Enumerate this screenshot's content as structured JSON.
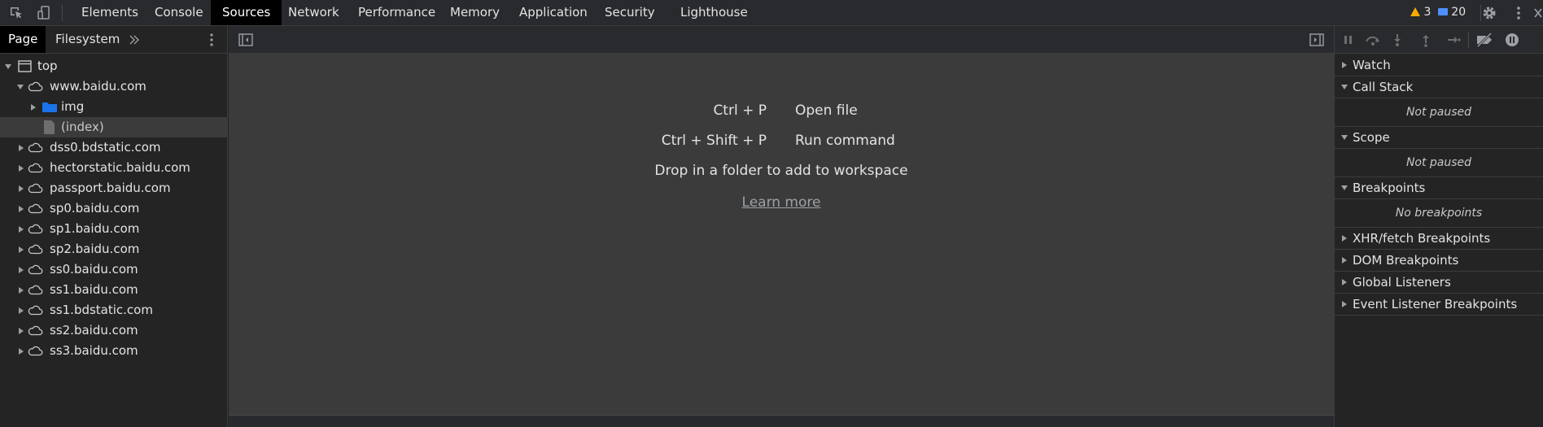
{
  "toolbar": {
    "tabs": [
      "Elements",
      "Console",
      "Sources",
      "Network",
      "Performance",
      "Memory",
      "Application",
      "Security",
      "Lighthouse"
    ],
    "active_tab": "Sources",
    "warnings_count": "3",
    "messages_count": "20"
  },
  "navigator": {
    "tabs": [
      "Page",
      "Filesystem"
    ],
    "active_tab": "Page",
    "tree": [
      {
        "label": "top",
        "type": "frame"
      },
      {
        "label": "www.baidu.com",
        "type": "domain"
      },
      {
        "label": "img",
        "type": "folder"
      },
      {
        "label": "(index)",
        "type": "file"
      },
      {
        "label": "dss0.bdstatic.com",
        "type": "domain"
      },
      {
        "label": "hectorstatic.baidu.com",
        "type": "domain"
      },
      {
        "label": "passport.baidu.com",
        "type": "domain"
      },
      {
        "label": "sp0.baidu.com",
        "type": "domain"
      },
      {
        "label": "sp1.baidu.com",
        "type": "domain"
      },
      {
        "label": "sp2.baidu.com",
        "type": "domain"
      },
      {
        "label": "ss0.baidu.com",
        "type": "domain"
      },
      {
        "label": "ss1.baidu.com",
        "type": "domain"
      },
      {
        "label": "ss1.bdstatic.com",
        "type": "domain"
      },
      {
        "label": "ss2.baidu.com",
        "type": "domain"
      },
      {
        "label": "ss3.baidu.com",
        "type": "domain"
      }
    ]
  },
  "editor": {
    "shortcuts": [
      {
        "key": "Ctrl + P",
        "action": "Open file"
      },
      {
        "key": "Ctrl + Shift + P",
        "action": "Run command"
      }
    ],
    "drop_text": "Drop in a folder to add to workspace",
    "learn_more": "Learn more"
  },
  "debugger": {
    "sections": [
      {
        "title": "Watch",
        "expanded": false
      },
      {
        "title": "Call Stack",
        "expanded": true,
        "body": "Not paused"
      },
      {
        "title": "Scope",
        "expanded": true,
        "body": "Not paused"
      },
      {
        "title": "Breakpoints",
        "expanded": true,
        "body": "No breakpoints"
      },
      {
        "title": "XHR/fetch Breakpoints",
        "expanded": false
      },
      {
        "title": "DOM Breakpoints",
        "expanded": false
      },
      {
        "title": "Global Listeners",
        "expanded": false
      },
      {
        "title": "Event Listener Breakpoints",
        "expanded": false
      }
    ]
  },
  "colors": {
    "active_tab_bg": "#000000",
    "warning": "#f9ab00",
    "info": "#4d8ffc",
    "folder": "#1a73e8"
  }
}
